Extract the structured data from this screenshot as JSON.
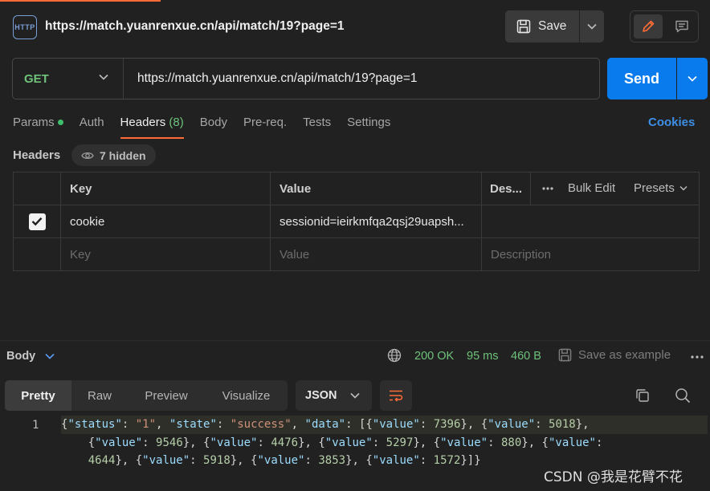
{
  "request": {
    "icon_label": "HTTP",
    "title": "https://match.yuanrenxue.cn/api/match/19?page=1",
    "save_label": "Save",
    "method": "GET",
    "url": "https://match.yuanrenxue.cn/api/match/19?page=1",
    "send_label": "Send"
  },
  "tabs": {
    "params": "Params",
    "auth": "Auth",
    "headers": "Headers",
    "headers_count": "(8)",
    "body": "Body",
    "prereq": "Pre-req.",
    "tests": "Tests",
    "settings": "Settings",
    "cookies": "Cookies"
  },
  "headers_section": {
    "label": "Headers",
    "hidden": "7 hidden",
    "columns": {
      "key": "Key",
      "value": "Value",
      "description": "Des..."
    },
    "bulk_edit": "Bulk Edit",
    "presets": "Presets",
    "rows": [
      {
        "key": "cookie",
        "value": "sessionid=ieirkmfqa2qsj29uapsh...",
        "checked": true
      }
    ],
    "placeholders": {
      "key": "Key",
      "value": "Value",
      "description": "Description"
    }
  },
  "response": {
    "body_label": "Body",
    "status": "200 OK",
    "time": "95 ms",
    "size": "460 B",
    "save_example": "Save as example",
    "views": [
      "Pretty",
      "Raw",
      "Preview",
      "Visualize"
    ],
    "format": "JSON",
    "line_number": "1",
    "json": {
      "status": "1",
      "state": "success",
      "values": [
        7396,
        5018,
        9546,
        4476,
        5297,
        880,
        4644,
        5918,
        3853,
        1572
      ]
    }
  },
  "watermark": "CSDN @我是花臂不花",
  "colors": {
    "accent": "#ff6c37",
    "send": "#097bed",
    "method_get": "#6ec27b",
    "link": "#3d8fe6"
  }
}
